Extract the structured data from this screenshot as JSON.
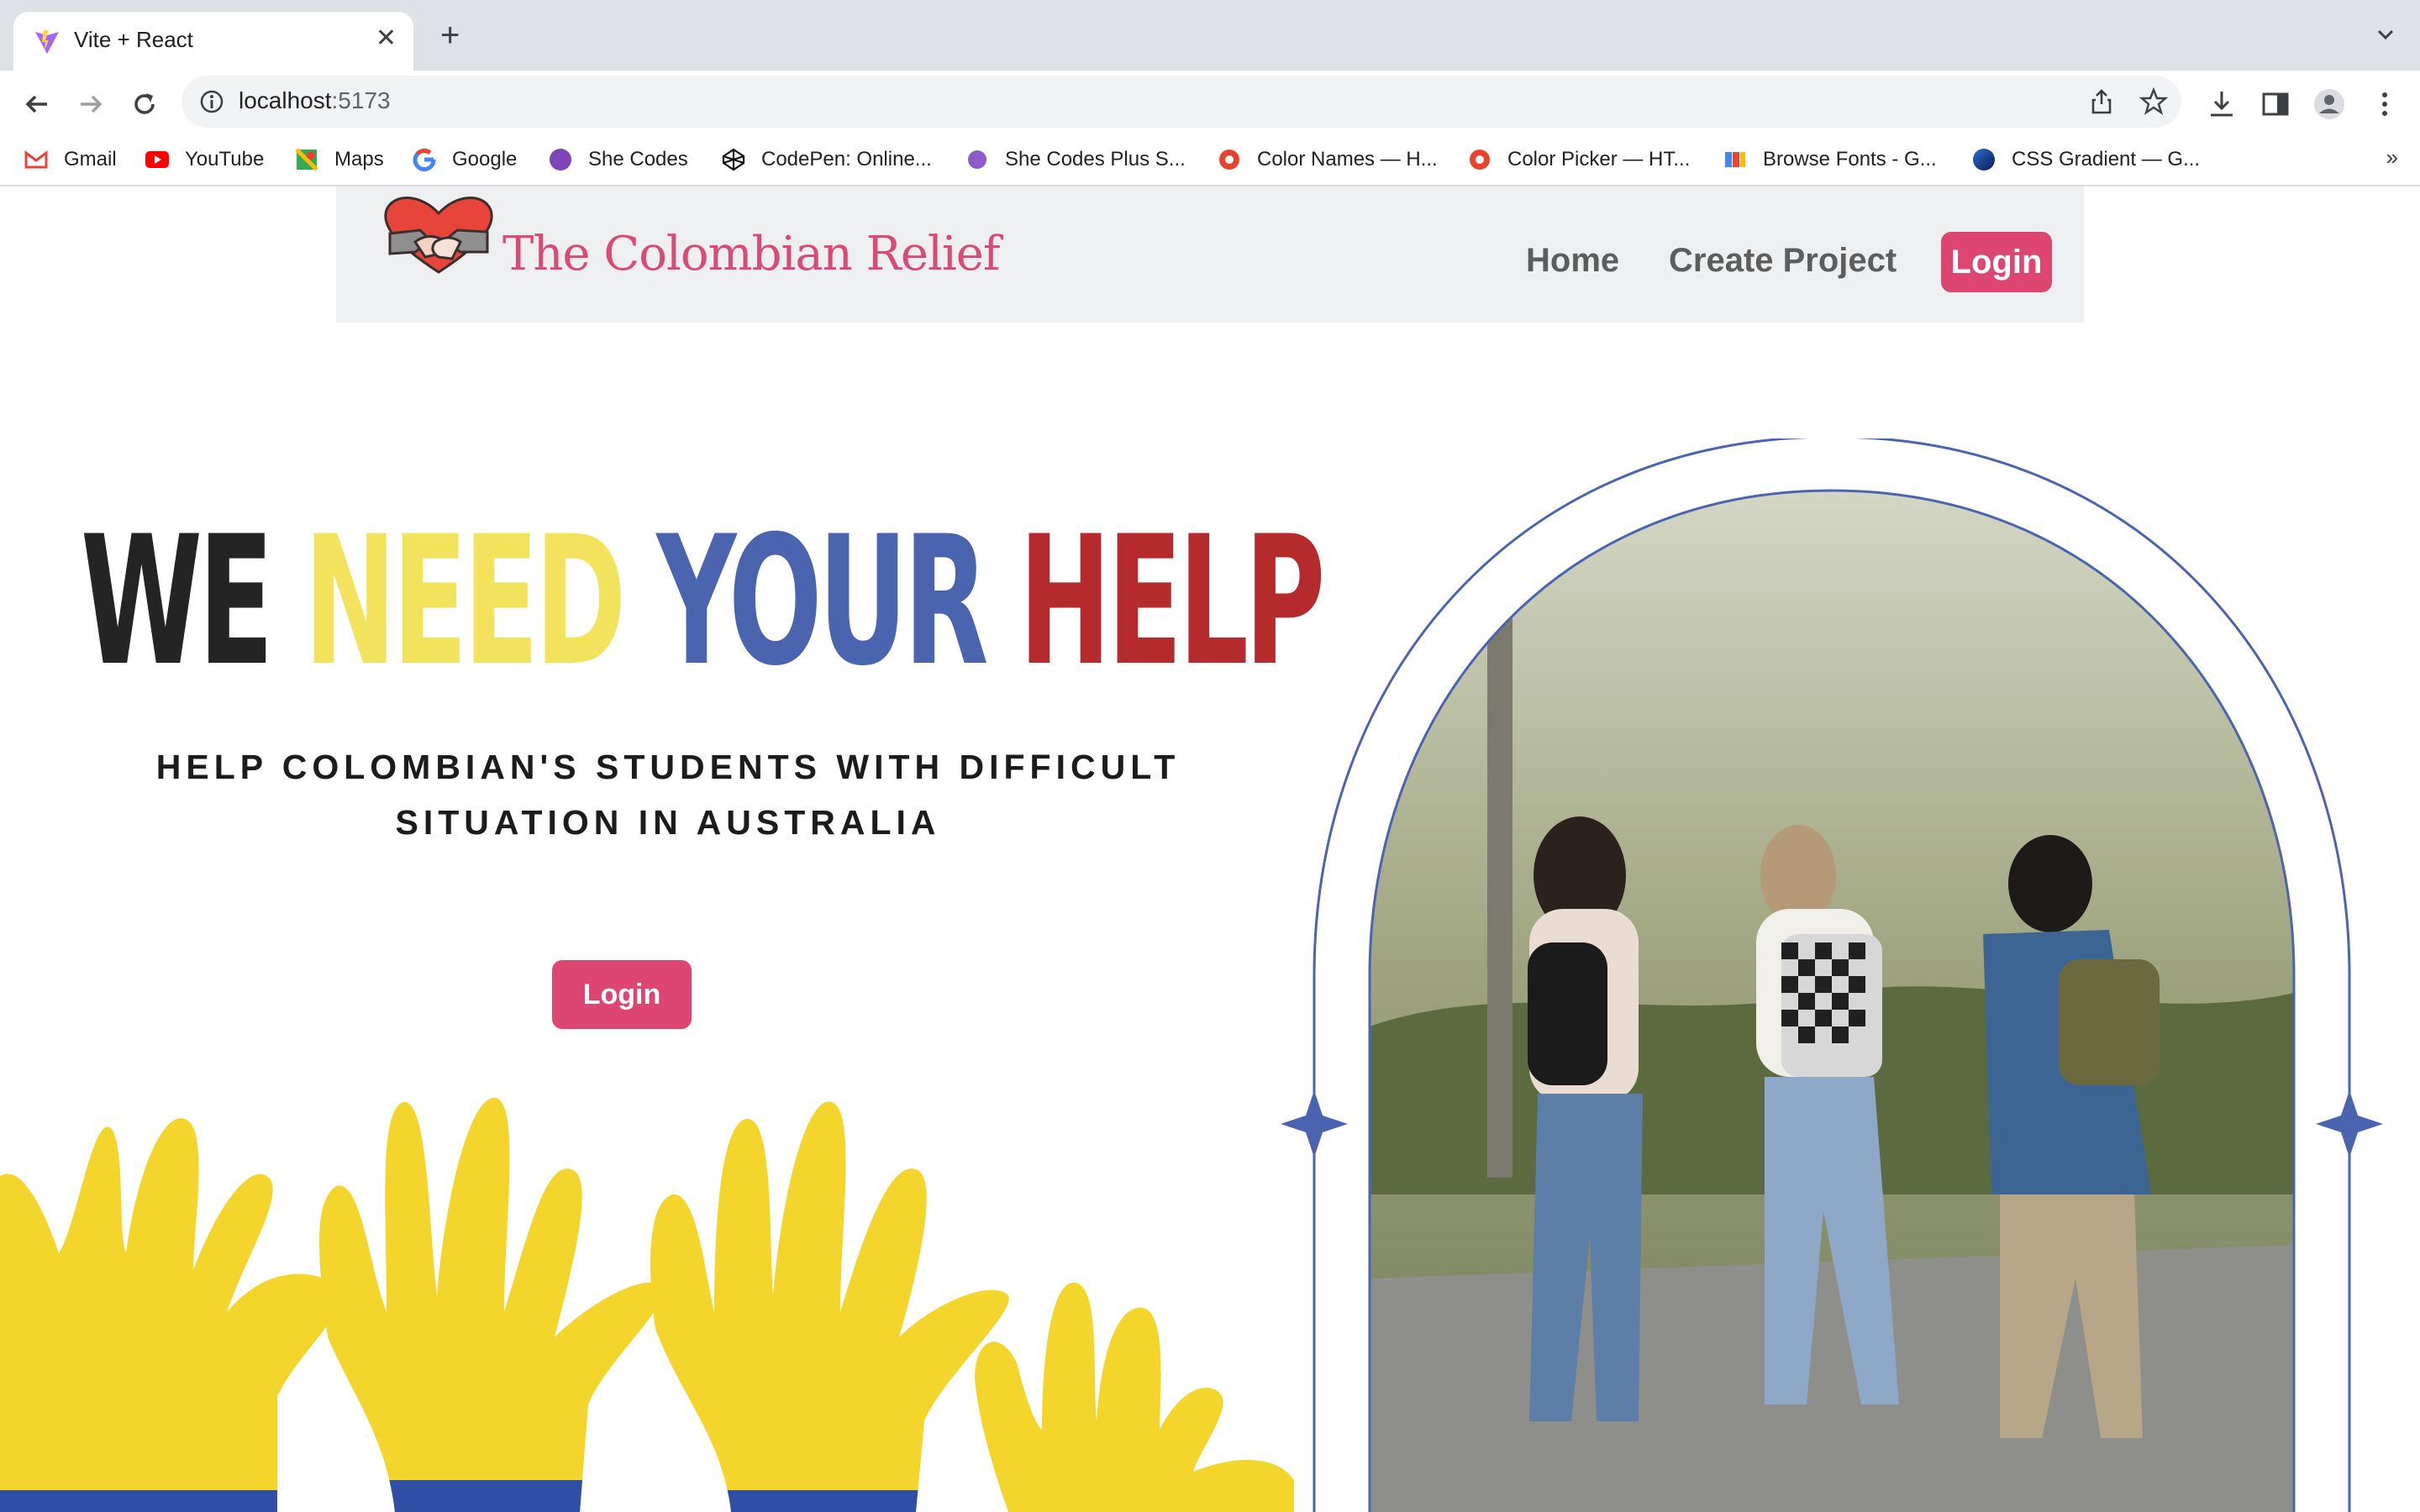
{
  "browser": {
    "tab_title": "Vite + React",
    "tab_close": "✕",
    "new_tab": "+",
    "url_host": "localhost",
    "url_port": ":5173",
    "bookmarks": [
      {
        "label": "Gmail",
        "icon": "gmail-icon"
      },
      {
        "label": "YouTube",
        "icon": "youtube-icon"
      },
      {
        "label": "Maps",
        "icon": "maps-icon"
      },
      {
        "label": "Google",
        "icon": "google-icon"
      },
      {
        "label": "She Codes",
        "icon": "shecodes-icon"
      },
      {
        "label": "CodePen: Online...",
        "icon": "codepen-icon"
      },
      {
        "label": "She Codes Plus S...",
        "icon": "shecodes-icon"
      },
      {
        "label": "Color Names — H...",
        "icon": "colorpicker-icon"
      },
      {
        "label": "Color Picker — HT...",
        "icon": "colorpicker-icon"
      },
      {
        "label": "Browse Fonts - G...",
        "icon": "fonts-icon"
      },
      {
        "label": "CSS Gradient — G...",
        "icon": "gradient-icon"
      }
    ],
    "bookmarks_more": "»"
  },
  "site": {
    "brand": "The Colombian Relief",
    "nav": {
      "home": "Home",
      "create_project": "Create Project",
      "login": "Login"
    },
    "hero": {
      "title_words": [
        "WE",
        "NEED",
        "YOUR",
        "HELP"
      ],
      "subtitle_line1": "HELP COLOMBIAN'S STUDENTS WITH DIFFICULT",
      "subtitle_line2": "SITUATION IN AUSTRALIA",
      "login_button": "Login"
    }
  },
  "colors": {
    "brand_pink": "#dd4670",
    "nav_bg": "#edeff0",
    "yellow": "#f3e35c",
    "blue": "#4b64b0",
    "red": "#b52a2c"
  }
}
